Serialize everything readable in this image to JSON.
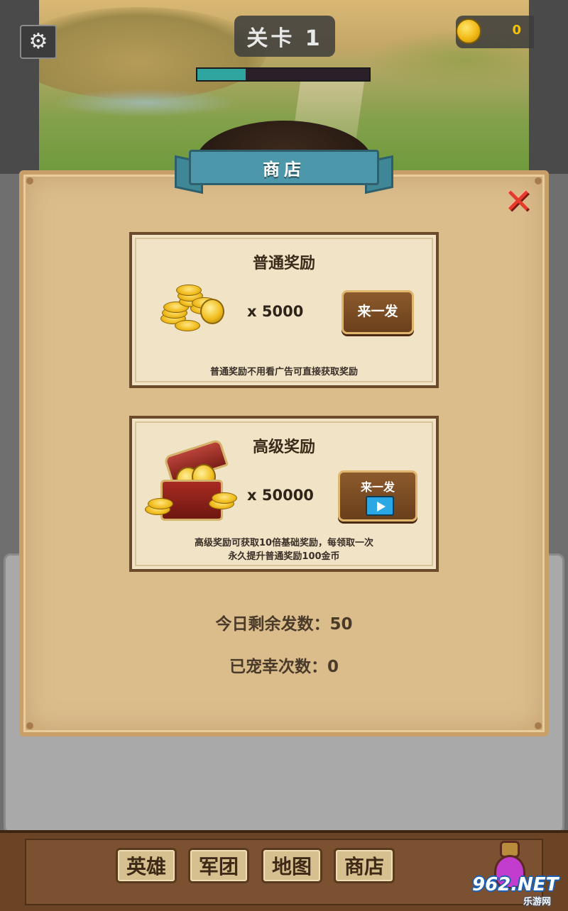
{
  "hud": {
    "settings_icon": "gear-icon",
    "level_label": "关卡 1",
    "level_progress": 0.28,
    "coin_count": "0"
  },
  "shop": {
    "title": "商店",
    "close_icon": "close-x-icon",
    "normal": {
      "title": "普通奖励",
      "quantity": "x 5000",
      "button_label": "来一发",
      "description": "普通奖励不用看广告可直接获取奖励"
    },
    "premium": {
      "title": "高级奖励",
      "quantity": "x 50000",
      "button_label": "来一发",
      "button_icon": "video-icon",
      "description_line1": "高级奖励可获取10倍基础奖励，每领取一次",
      "description_line2": "永久提升普通奖励100金币"
    },
    "remaining_today": "今日剩余发数：50",
    "favored_count": "已宠幸次数：0"
  },
  "nav": {
    "items": [
      {
        "label": "英雄"
      },
      {
        "label": "军团"
      },
      {
        "label": "地图"
      },
      {
        "label": "商店"
      }
    ]
  },
  "watermark": {
    "logo": "962.NET",
    "sub": "乐游网"
  },
  "colors": {
    "panel": "#dbbd8c",
    "banner": "#4c97aa",
    "button": "#7a4a22",
    "progress_fill": "#2fa5a0",
    "coin_text": "#f5c400",
    "close": "#e63a2a"
  }
}
